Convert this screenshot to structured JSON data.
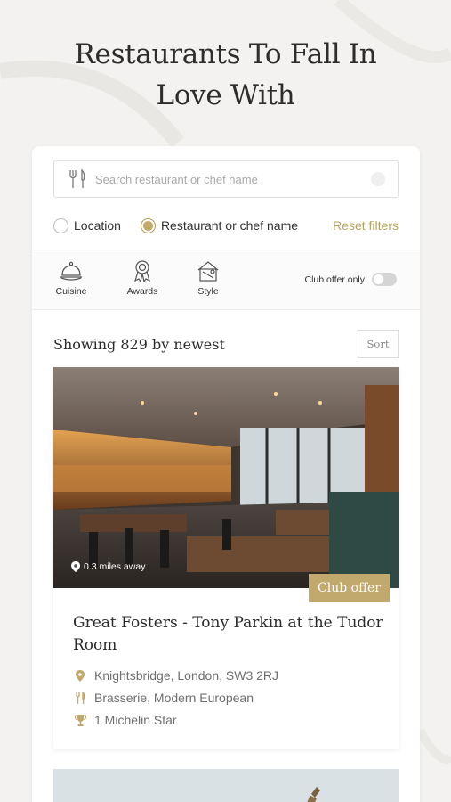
{
  "page": {
    "title_line1": "Restaurants To Fall In",
    "title_line2": "Love With"
  },
  "search": {
    "placeholder": "Search restaurant or chef name",
    "value": ""
  },
  "radios": [
    {
      "label": "Location",
      "selected": false
    },
    {
      "label": "Restaurant or chef name",
      "selected": true
    }
  ],
  "reset_label": "Reset filters",
  "filters": [
    {
      "label": "Cuisine",
      "icon": "cloche-icon"
    },
    {
      "label": "Awards",
      "icon": "rosette-icon"
    },
    {
      "label": "Style",
      "icon": "style-icon"
    }
  ],
  "club_offer_toggle": {
    "label": "Club offer only",
    "on": false
  },
  "results_header": {
    "showing": "Showing 829 by newest",
    "sort_label": "Sort"
  },
  "result": {
    "distance": "0.3 miles away",
    "badge": "Club offer",
    "name": "Great Fosters - Tony Parkin at the Tudor Room",
    "address": "Knightsbridge, London, SW3 2RJ",
    "cuisine": "Brasserie, Modern European",
    "award": "1 Michelin Star"
  },
  "colors": {
    "accent": "#c1a86c",
    "text": "#2b2b2b",
    "muted": "#6f6f6f"
  }
}
